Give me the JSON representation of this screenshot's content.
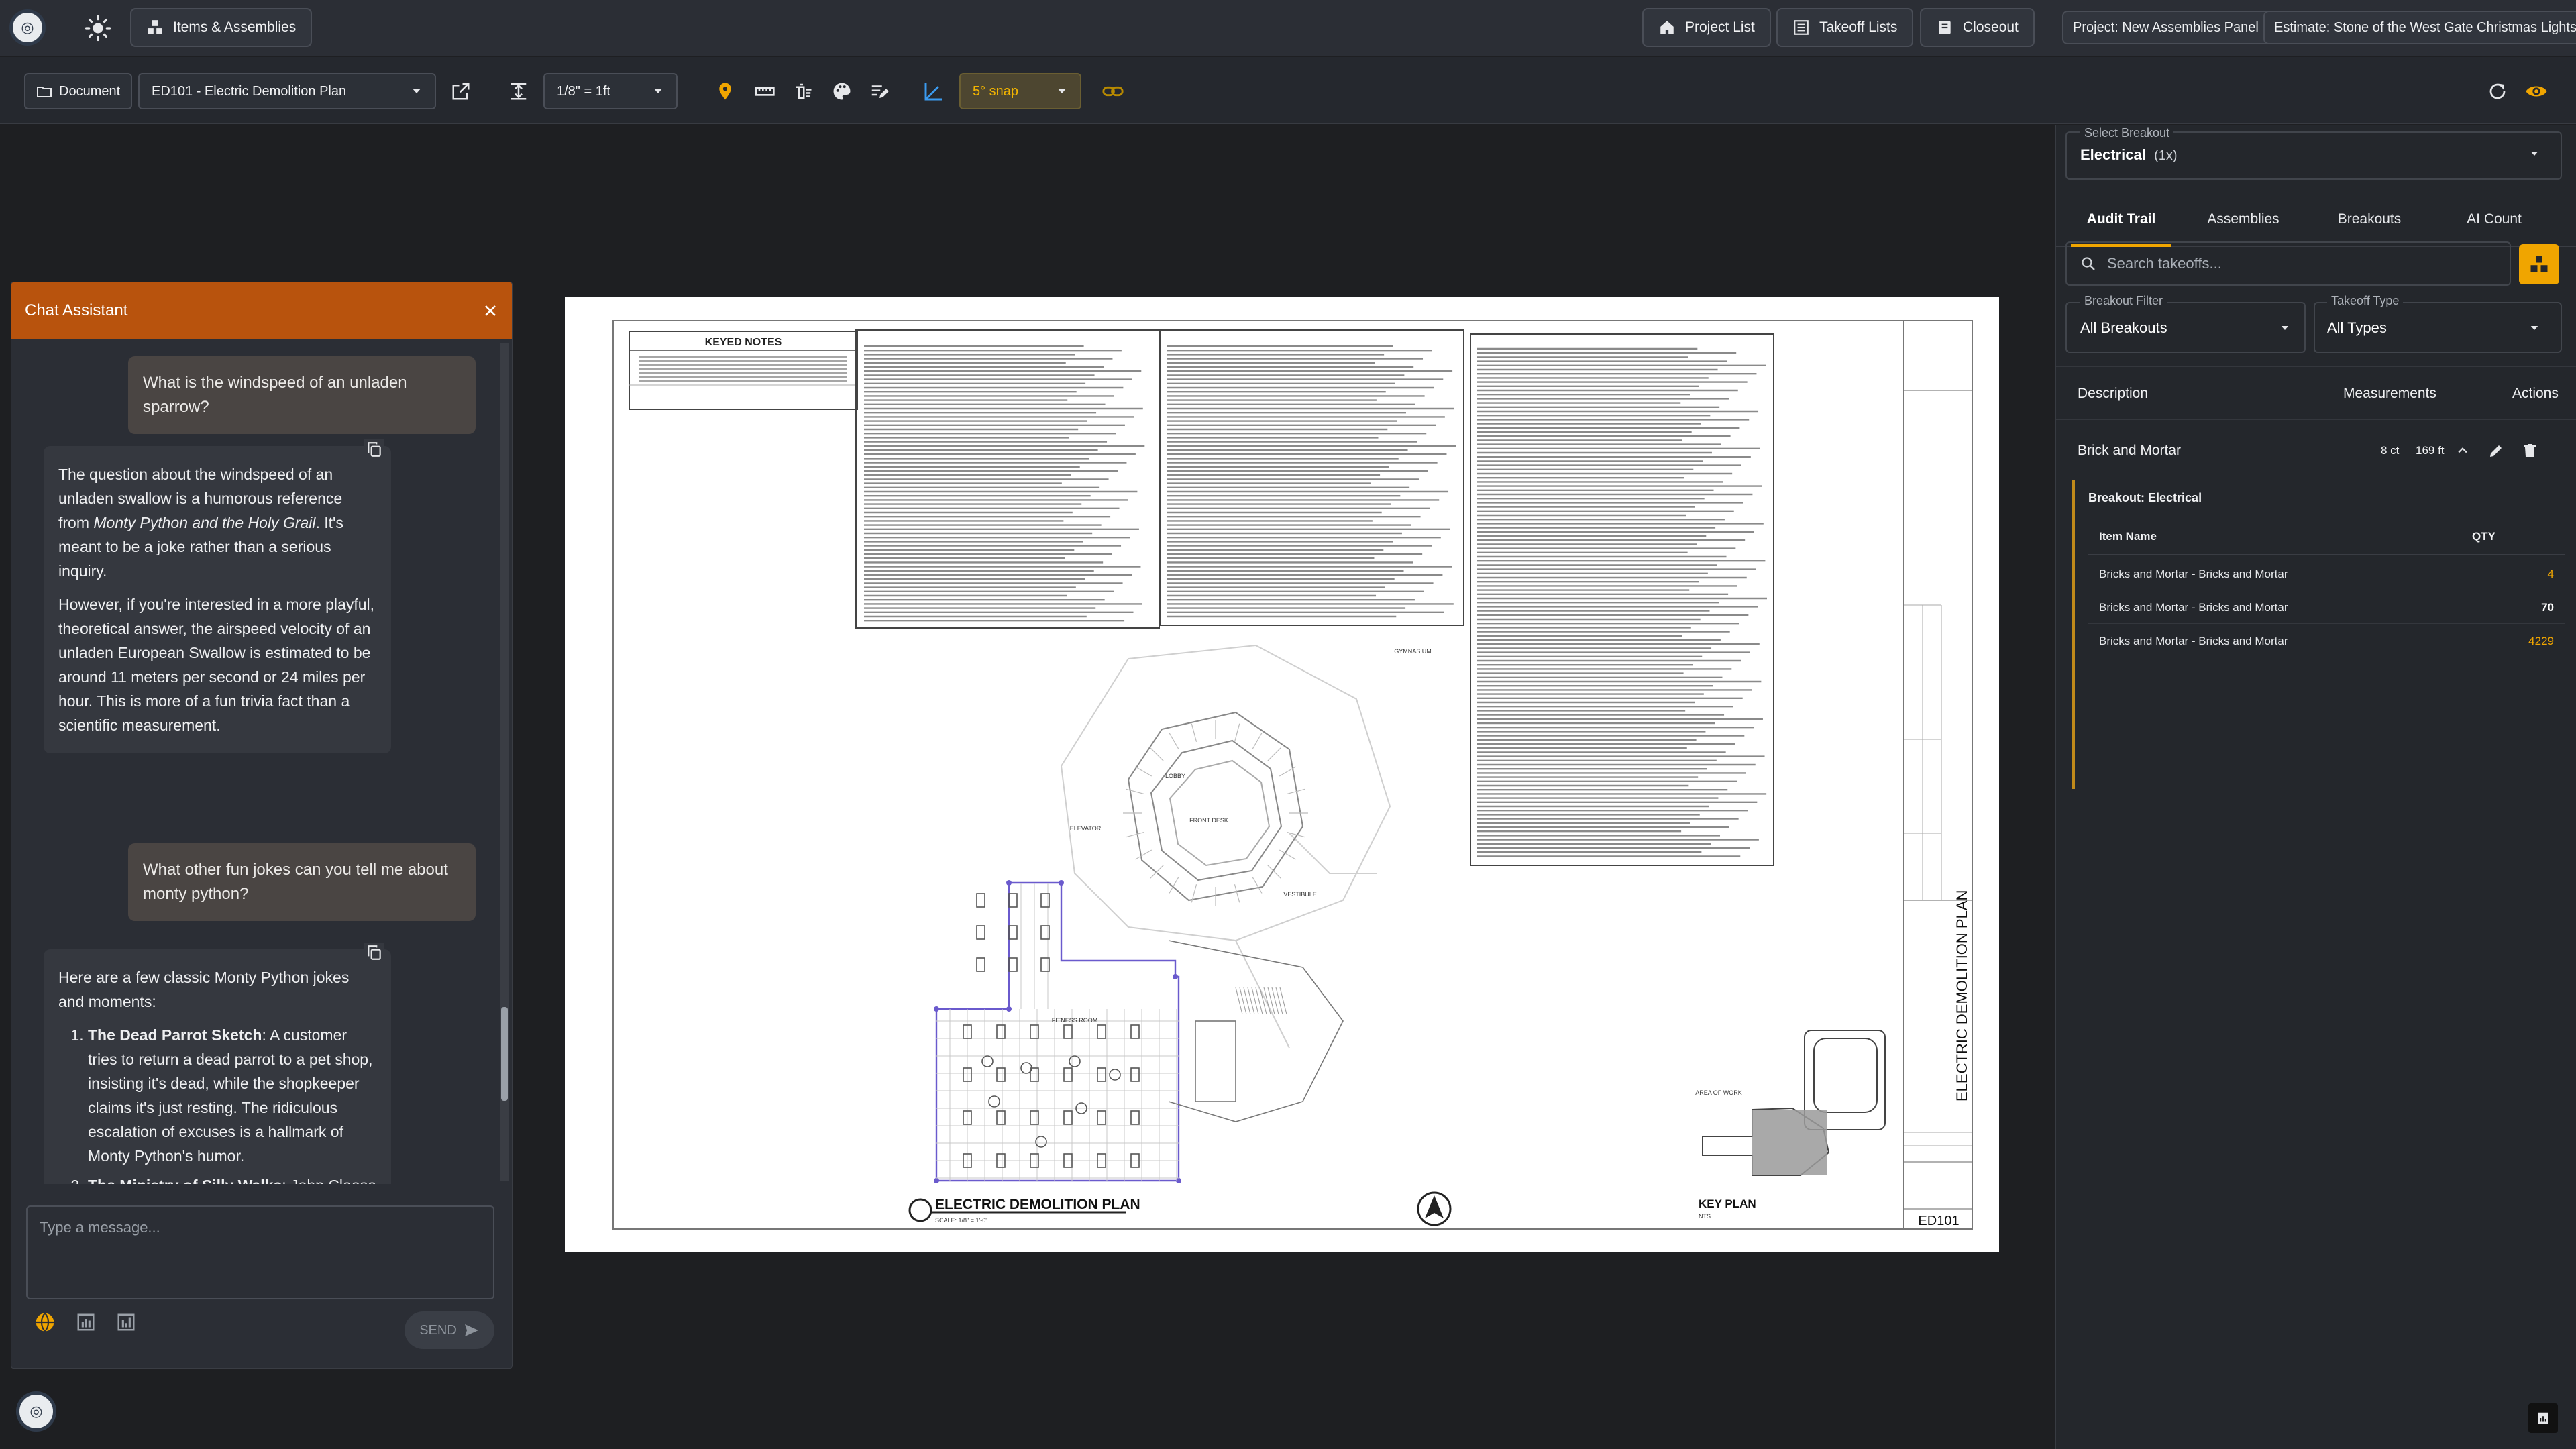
{
  "topbar": {
    "items_label": "Items & Assemblies",
    "project_list": "Project List",
    "takeoff_lists": "Takeoff Lists",
    "closeout": "Closeout",
    "project": "Project: New Assemblies Panel",
    "estimate": "Estimate: Stone of the West Gate Christmas Lights"
  },
  "toolbar": {
    "document_label": "Document",
    "sheet": "ED101 - Electric Demolition Plan",
    "scale": "1/8\" = 1ft",
    "snap": "5° snap"
  },
  "drawing": {
    "keyed_notes_title": "KEYED NOTES",
    "plan_title": "ELECTRIC DEMOLITION PLAN",
    "plan_scale": "SCALE: 1/8\" = 1'-0\"",
    "key_plan": "KEY PLAN",
    "key_plan_sub": "NTS",
    "sheet_title_vertical": "ELECTRIC DEMOLITION PLAN",
    "sheet_number": "ED101",
    "labels": [
      "LOBBY",
      "FRONT DESK",
      "ELEVATOR",
      "FITNESS ROOM",
      "VESTIBULE",
      "GYMNASIUM",
      "AREA OF WORK"
    ]
  },
  "chat": {
    "title": "Chat Assistant",
    "messages": [
      {
        "role": "user",
        "text": "What is the windspeed of an unladen sparrow?"
      },
      {
        "role": "assistant",
        "p1_a": "The question about the windspeed of an unladen swallow is a humorous reference from ",
        "p1_em": "Monty Python and the Holy Grail",
        "p1_b": ". It's meant to be a joke rather than a serious inquiry.",
        "p2": "However, if you're interested in a more playful, theoretical answer, the airspeed velocity of an unladen European Swallow is estimated to be around 11 meters per second or 24 miles per hour. This is more of a fun trivia fact than a scientific measurement."
      },
      {
        "role": "user",
        "text": "What other fun jokes can you tell me about monty python?"
      },
      {
        "role": "assistant",
        "intro": "Here are a few classic Monty Python jokes and moments:",
        "items": [
          {
            "title": "The Dead Parrot Sketch",
            "text": ": A customer tries to return a dead parrot to a pet shop, insisting it's dead, while the shopkeeper claims it's just resting. The ridiculous escalation of excuses is a hallmark of Monty Python's humor."
          },
          {
            "title": "The Ministry of Silly Walks",
            "text": ": John Cleese plays a government official in"
          }
        ]
      }
    ],
    "input_placeholder": "Type a message...",
    "send_label": "SEND"
  },
  "panel": {
    "select_breakout_label": "Select Breakout",
    "select_breakout_value": "Electrical",
    "select_breakout_count": "(1x)",
    "tabs": [
      "Audit Trail",
      "Assemblies",
      "Breakouts",
      "AI Count"
    ],
    "search_placeholder": "Search takeoffs...",
    "breakout_filter_label": "Breakout Filter",
    "breakout_filter_value": "All Breakouts",
    "takeoff_type_label": "Takeoff Type",
    "takeoff_type_value": "All Types",
    "columns": {
      "description": "Description",
      "measurements": "Measurements",
      "actions": "Actions"
    },
    "takeoff": {
      "name": "Brick and Mortar",
      "count": "8 ct",
      "length": "169 ft"
    },
    "breakout_title": "Breakout: Electrical",
    "sub_columns": {
      "item": "Item Name",
      "qty": "QTY"
    },
    "sub_rows": [
      {
        "name": "Bricks and Mortar - Bricks and Mortar",
        "qty": "4"
      },
      {
        "name": "Bricks and Mortar - Bricks and Mortar",
        "qty": "70"
      },
      {
        "name": "Bricks and Mortar - Bricks and Mortar",
        "qty": "4229"
      }
    ]
  },
  "colors": {
    "accent": "#f0a500",
    "chat_header": "#b8530d",
    "qty_orange": "#f0a500"
  }
}
